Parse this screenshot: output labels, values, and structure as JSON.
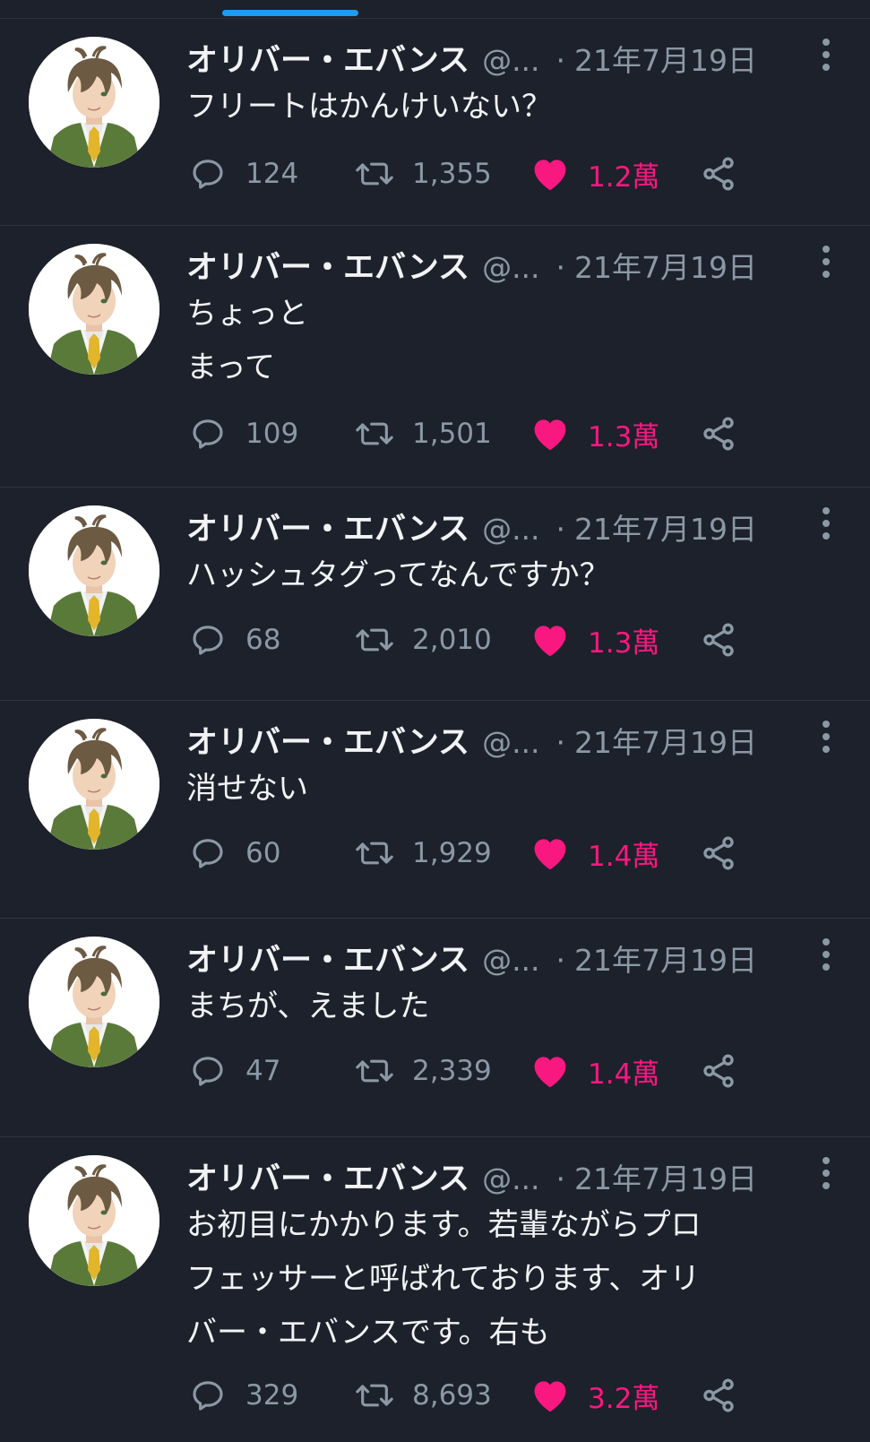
{
  "colors": {
    "background": "#1c212b",
    "accent_blue": "#1d9bf0",
    "like_pink": "#f91880",
    "muted_text": "#8b98a5"
  },
  "tweets": [
    {
      "name": "オリバー・エバンス",
      "handle": "@...",
      "separator": "·",
      "date": "21年7月19日",
      "text": "フリートはかんけいない？",
      "replies": "124",
      "retweets": "1,355",
      "likes": "1.2萬"
    },
    {
      "name": "オリバー・エバンス",
      "handle": "@...",
      "separator": "·",
      "date": "21年7月19日",
      "text": "ちょっと\nまって",
      "replies": "109",
      "retweets": "1,501",
      "likes": "1.3萬"
    },
    {
      "name": "オリバー・エバンス",
      "handle": "@...",
      "separator": "·",
      "date": "21年7月19日",
      "text": "ハッシュタグってなんですか？",
      "replies": "68",
      "retweets": "2,010",
      "likes": "1.3萬"
    },
    {
      "name": "オリバー・エバンス",
      "handle": "@...",
      "separator": "·",
      "date": "21年7月19日",
      "text": "消せない",
      "replies": "60",
      "retweets": "1,929",
      "likes": "1.4萬"
    },
    {
      "name": "オリバー・エバンス",
      "handle": "@...",
      "separator": "·",
      "date": "21年7月19日",
      "text": "まちが、えました",
      "replies": "47",
      "retweets": "2,339",
      "likes": "1.4萬"
    },
    {
      "name": "オリバー・エバンス",
      "handle": "@...",
      "separator": "·",
      "date": "21年7月19日",
      "text": "お初目にかかります。若輩ながらプロ\nフェッサーと呼ばれております、オリ\nバー・エバンスです。右も",
      "replies": "329",
      "retweets": "8,693",
      "likes": "3.2萬"
    }
  ]
}
